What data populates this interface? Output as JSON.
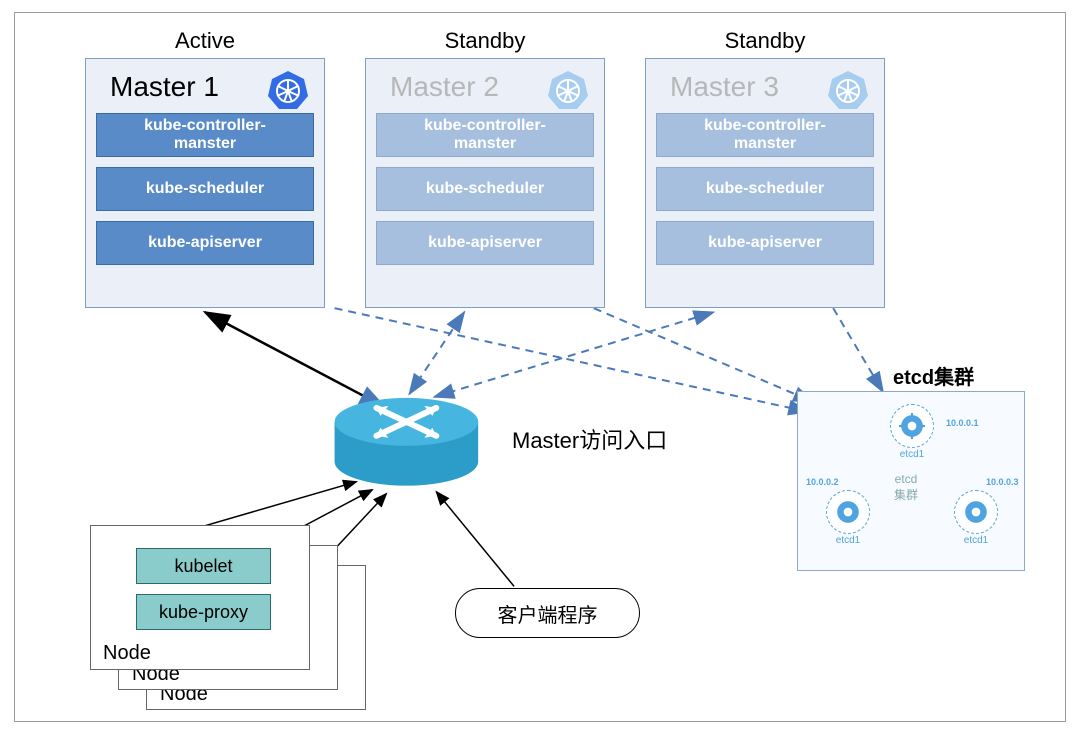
{
  "masters": [
    {
      "status": "Active",
      "title": "Master 1",
      "components": [
        "kube-controller-\nmanster",
        "kube-scheduler",
        "kube-apiserver"
      ],
      "active": true
    },
    {
      "status": "Standby",
      "title": "Master 2",
      "components": [
        "kube-controller-\nmanster",
        "kube-scheduler",
        "kube-apiserver"
      ],
      "active": false
    },
    {
      "status": "Standby",
      "title": "Master 3",
      "components": [
        "kube-controller-\nmanster",
        "kube-scheduler",
        "kube-apiserver"
      ],
      "active": false
    }
  ],
  "router_label": "Master访问入口",
  "nodes": {
    "labels": [
      "Node",
      "Node",
      "Node"
    ],
    "components": [
      "kubelet",
      "kube-proxy"
    ]
  },
  "client_label": "客户端程序",
  "etcd": {
    "title": "etcd集群",
    "center_label": "etcd\n集群",
    "nodes": [
      {
        "name": "etcd1",
        "ip": "10.0.0.1"
      },
      {
        "name": "etcd1",
        "ip": "10.0.0.2"
      },
      {
        "name": "etcd1",
        "ip": "10.0.0.3"
      }
    ]
  },
  "colors": {
    "active_blue": "#5a8bc9",
    "inactive_blue": "#a6bfdf",
    "panel_bg": "#ebeff7",
    "router_cyan": "#2c9cc9",
    "etcd_blue": "#4fa3e0",
    "node_teal": "#8acccc"
  }
}
